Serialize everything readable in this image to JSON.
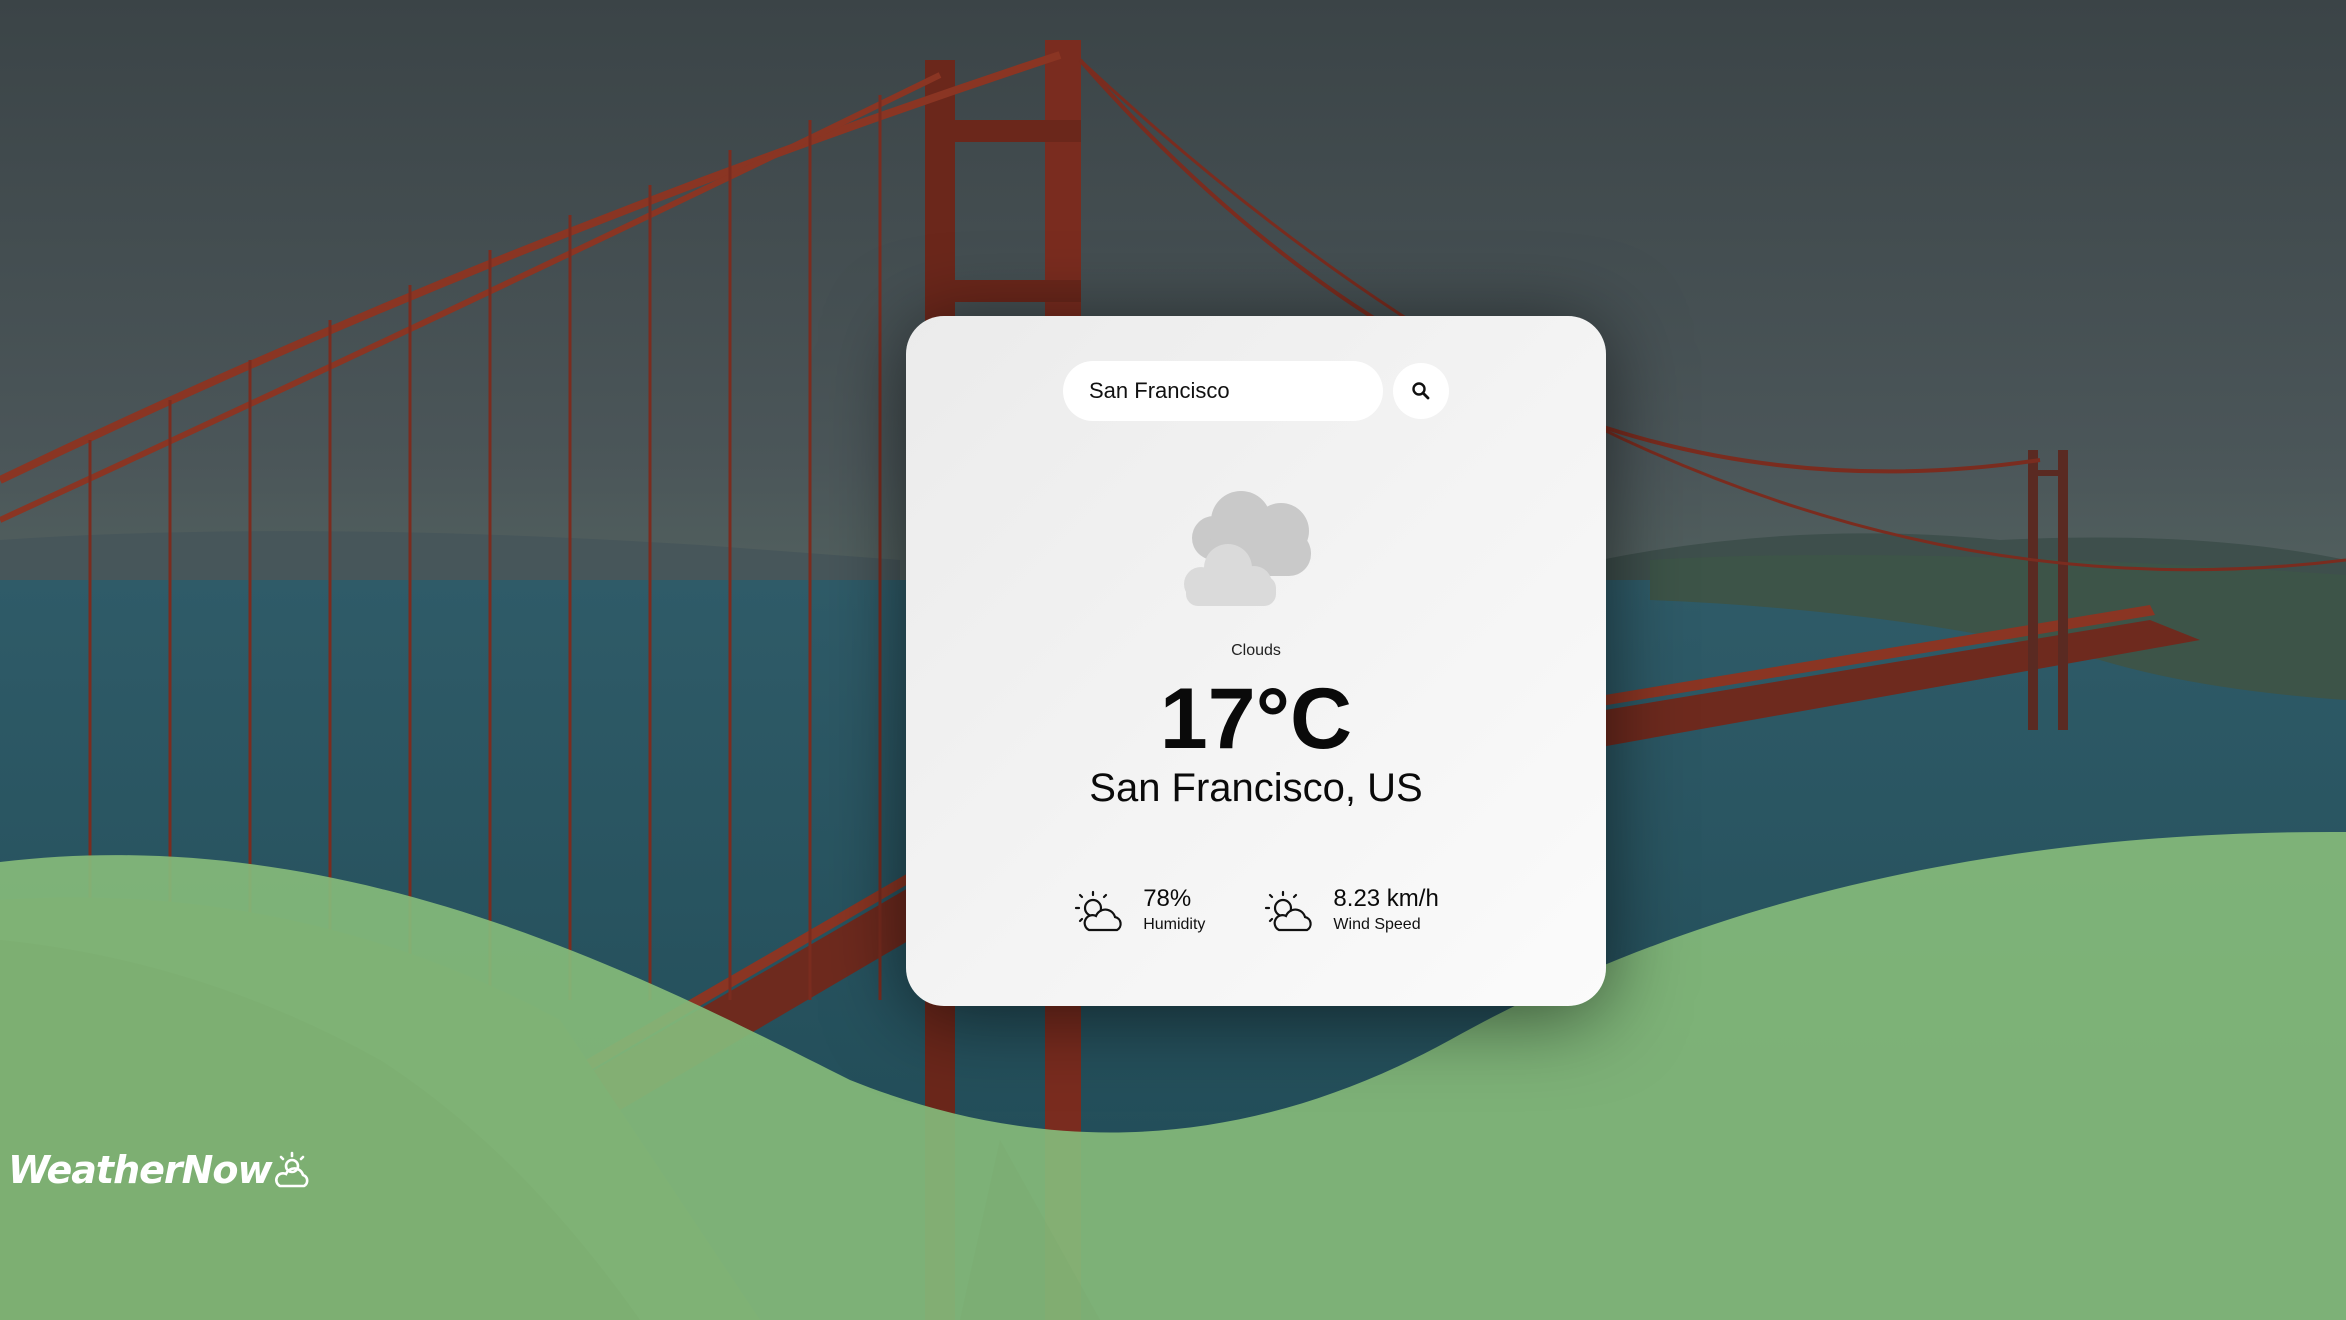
{
  "search": {
    "value": "San Francisco",
    "placeholder": ""
  },
  "search_button_icon": "search-icon",
  "weather": {
    "condition": "Clouds",
    "condition_icon": "cloud-icon",
    "temperature": "17°C",
    "location": "San Francisco, US"
  },
  "stats": {
    "humidity": {
      "value": "78%",
      "label": "Humidity",
      "icon": "partly-cloudy-icon"
    },
    "wind": {
      "value": "8.23 km/h",
      "label": "Wind Speed",
      "icon": "partly-cloudy-icon"
    }
  },
  "brand": {
    "name": "WeatherNow",
    "icon": "sun-cloud-icon"
  },
  "colors": {
    "wave_green": "#84b97a",
    "card_bg": "#f2f2f2",
    "text": "#0a0a0a"
  }
}
